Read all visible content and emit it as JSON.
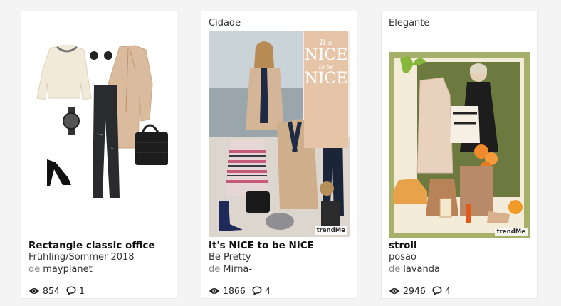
{
  "cards": [
    {
      "category": "",
      "title": "Rectangle classic office",
      "subtitle": "Frühling/Sommer 2018",
      "by_label": "de",
      "author": "mayplanet",
      "views": "854",
      "comments": "1"
    },
    {
      "category": "Cidade",
      "title": "It's NICE to be NICE",
      "subtitle": "Be Pretty",
      "by_label": "de",
      "author": "Mirna-",
      "views": "1866",
      "comments": "4",
      "poster": {
        "line1": "It's",
        "line2": "NICE",
        "line3": "to be",
        "line4": "NICE"
      },
      "watermark": "trendMe"
    },
    {
      "category": "Elegante",
      "title": "stroll",
      "subtitle": "posao",
      "by_label": "de",
      "author": "lavanda",
      "views": "2946",
      "comments": "4",
      "watermark": "trendMe"
    }
  ],
  "icons": {
    "views": "eye-icon",
    "comments": "speech-bubble-icon"
  }
}
